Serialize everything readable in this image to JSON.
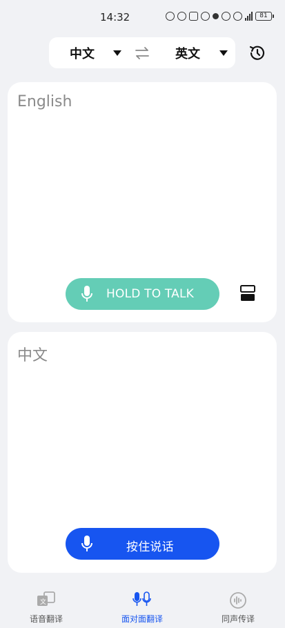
{
  "status_bar": {
    "time": "14:32",
    "battery": "81"
  },
  "language_bar": {
    "source_lang": "中文",
    "target_lang": "英文"
  },
  "top_panel": {
    "placeholder": "English",
    "talk_label": "HOLD TO TALK"
  },
  "bottom_panel": {
    "placeholder": "中文",
    "talk_label": "按住说话"
  },
  "nav": {
    "items": [
      {
        "label": "语音翻译",
        "icon": "translate-icon",
        "active": false
      },
      {
        "label": "面对面翻译",
        "icon": "face-to-face-mic-icon",
        "active": true
      },
      {
        "label": "同声传译",
        "icon": "simultaneous-interpretation-icon",
        "active": false
      }
    ]
  },
  "colors": {
    "accent_blue": "#1755f0",
    "accent_green": "#64cdb6",
    "background": "#f1f2f5"
  }
}
